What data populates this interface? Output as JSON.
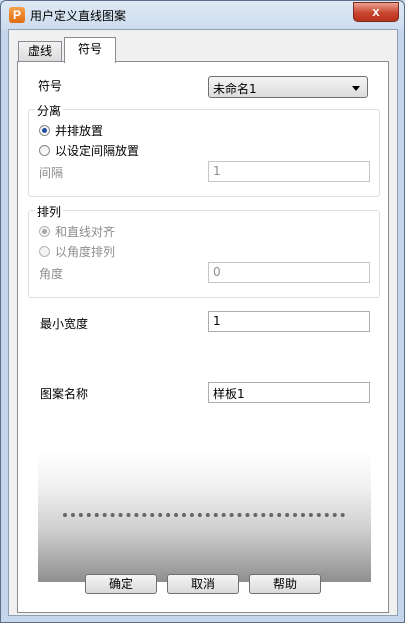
{
  "window": {
    "title": "用户定义直线图案",
    "icon_letter": "P",
    "close_label": "x"
  },
  "tabs": [
    {
      "label": "虚线",
      "active": false
    },
    {
      "label": "符号",
      "active": true
    }
  ],
  "symbol": {
    "label": "符号",
    "selected": "未命名1"
  },
  "separation": {
    "title": "分离",
    "options": [
      {
        "label": "并排放置",
        "checked": true
      },
      {
        "label": "以设定间隔放置",
        "checked": false
      }
    ],
    "spacing_label": "间隔",
    "spacing_value": "1"
  },
  "arrangement": {
    "title": "排列",
    "options": [
      {
        "label": "和直线对齐",
        "checked": true
      },
      {
        "label": "以角度排列",
        "checked": false
      }
    ],
    "angle_label": "角度",
    "angle_value": "0"
  },
  "min_width": {
    "label": "最小宽度",
    "value": "1"
  },
  "pattern_name": {
    "label": "图案名称",
    "value": "样板1"
  },
  "buttons": {
    "ok": "确定",
    "cancel": "取消",
    "help": "帮助"
  }
}
